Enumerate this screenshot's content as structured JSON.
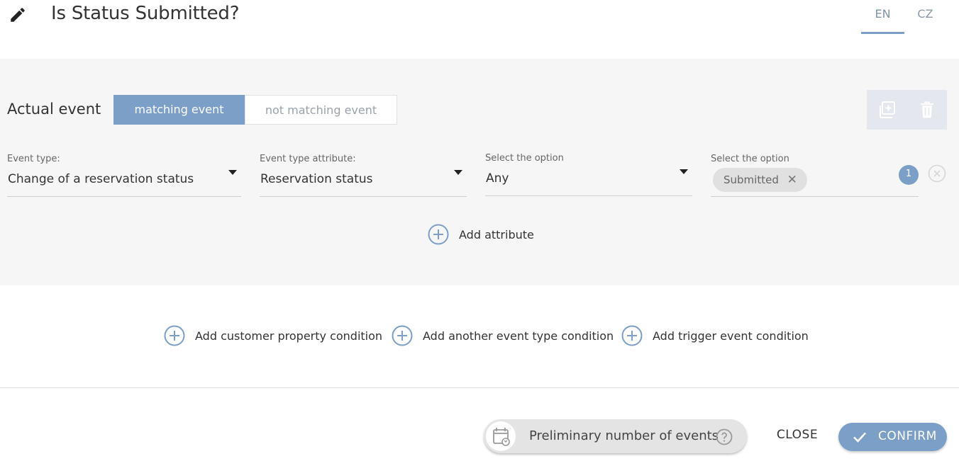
{
  "header": {
    "title": "Is Status Submitted?",
    "edit_icon": "pencil-icon",
    "languages": [
      {
        "code": "EN",
        "active": true
      },
      {
        "code": "CZ",
        "active": false
      }
    ]
  },
  "event_block": {
    "label": "Actual event",
    "toggle": {
      "matching": "matching event",
      "not_matching": "not matching event",
      "selected": "matching event"
    },
    "actions": {
      "duplicate_icon": "duplicate-icon",
      "delete_icon": "trash-icon"
    },
    "fields": [
      {
        "label": "Event type:",
        "value": "Change of a reservation status"
      },
      {
        "label": "Event type attribute:",
        "value": "Reservation status"
      },
      {
        "label": "Select the option",
        "value": "Any"
      },
      {
        "label": "Select the option",
        "chip": "Submitted",
        "count": "1"
      }
    ],
    "add_attribute": "Add attribute"
  },
  "conditions": {
    "customer_property": "Add customer property condition",
    "another_event": "Add another event type condition",
    "trigger_event": "Add trigger event condition"
  },
  "footer": {
    "preliminary": "Preliminary number of events",
    "close": "CLOSE",
    "confirm": "CONFIRM"
  },
  "colors": {
    "accent": "#7b9fc7",
    "panel_bg": "#f6f6f6",
    "chip_bg": "#e0e0e0"
  }
}
